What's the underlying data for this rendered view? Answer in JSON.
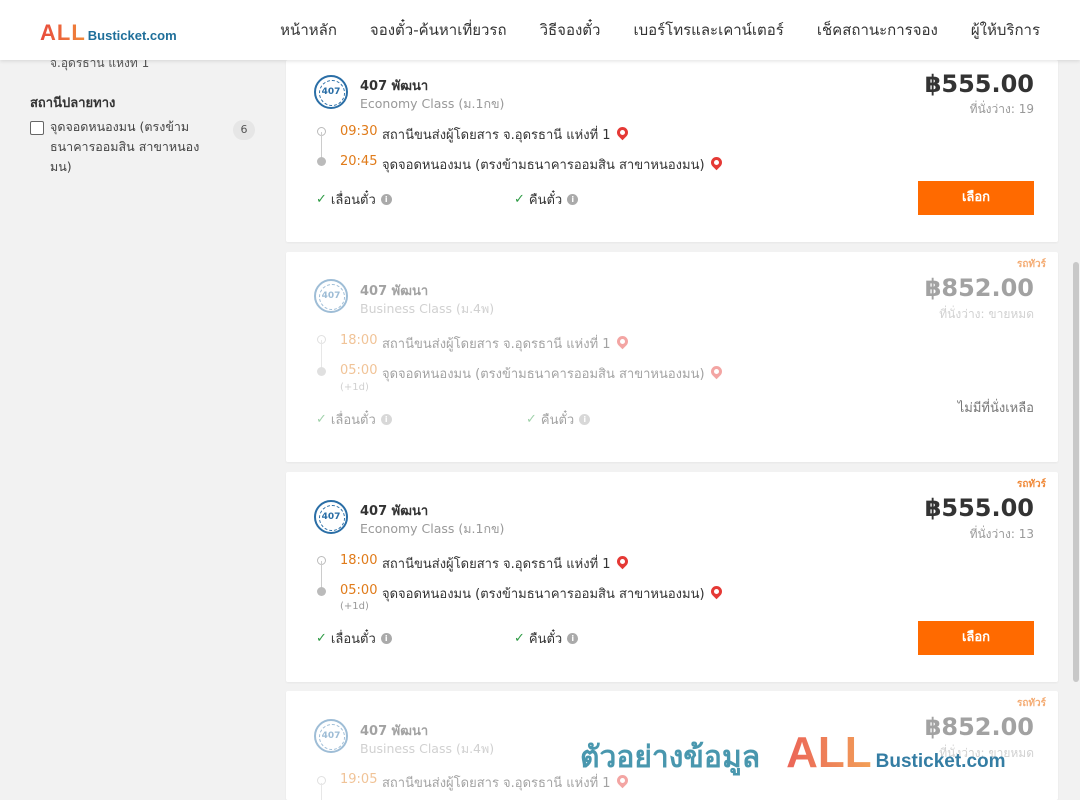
{
  "header": {
    "logo_all": "ALL",
    "logo_rest": "Busticket.com",
    "nav": [
      "หน้าหลัก",
      "จองตั๋ว-ค้นหาเที่ยวรถ",
      "วิธีจองตั๋ว",
      "เบอร์โทรและเคาน์เตอร์",
      "เช็คสถานะการจอง",
      "ผู้ให้บริการ"
    ]
  },
  "sidebar": {
    "cut_text": "จ.อุดรธานี แห่งที่ 1",
    "dest_title": "สถานีปลายทาง",
    "option_label": "จุดจอดหนองมน (ตรงข้ามธนาคารออมสิน สาขาหนองมน)",
    "option_count": "6"
  },
  "trips": [
    {
      "tag": "",
      "operator": "407 พัฒนา",
      "logo_text": "407",
      "bus_class": "Economy Class (ม.1กข)",
      "price": "฿555.00",
      "seats": "ที่นั่งว่าง: 19",
      "dep_time": "09:30",
      "dep_stop": "สถานีขนส่งผู้โดยสาร จ.อุดรธานี แห่งที่ 1",
      "arr_time": "20:45",
      "arr_stop": "จุดจอดหนองมน (ตรงข้ามธนาคารออมสิน สาขาหนองมน)",
      "next_day": "",
      "feature1": "เลื่อนตั๋ว",
      "feature2": "คืนตั๋ว",
      "action": "เลือก"
    },
    {
      "tag": "รถทัวร์",
      "operator": "407 พัฒนา",
      "logo_text": "407",
      "bus_class": "Business Class (ม.4พ)",
      "price": "฿852.00",
      "seats": "ที่นั่งว่าง: ขายหมด",
      "dep_time": "18:00",
      "dep_stop": "สถานีขนส่งผู้โดยสาร จ.อุดรธานี แห่งที่ 1",
      "arr_time": "05:00",
      "arr_stop": "จุดจอดหนองมน (ตรงข้ามธนาคารออมสิน สาขาหนองมน)",
      "next_day": "(+1d)",
      "feature1": "เลื่อนตั๋ว",
      "feature2": "คืนตั๋ว",
      "action": "ไม่มีที่นั่งเหลือ"
    },
    {
      "tag": "รถทัวร์",
      "operator": "407 พัฒนา",
      "logo_text": "407",
      "bus_class": "Economy Class (ม.1กข)",
      "price": "฿555.00",
      "seats": "ที่นั่งว่าง: 13",
      "dep_time": "18:00",
      "dep_stop": "สถานีขนส่งผู้โดยสาร จ.อุดรธานี แห่งที่ 1",
      "arr_time": "05:00",
      "arr_stop": "จุดจอดหนองมน (ตรงข้ามธนาคารออมสิน สาขาหนองมน)",
      "next_day": "(+1d)",
      "feature1": "เลื่อนตั๋ว",
      "feature2": "คืนตั๋ว",
      "action": "เลือก"
    },
    {
      "tag": "รถทัวร์",
      "operator": "407 พัฒนา",
      "logo_text": "407",
      "bus_class": "Business Class (ม.4พ)",
      "price": "฿852.00",
      "seats": "ที่นั่งว่าง: ขายหมด",
      "dep_time": "19:05",
      "dep_stop": "สถานีขนส่งผู้โดยสาร จ.อุดรธานี แห่งที่ 1"
    }
  ],
  "watermark": {
    "text": "ตัวอย่างข้อมูล",
    "logo_all": "ALL",
    "logo_rest": "Busticket.com"
  }
}
